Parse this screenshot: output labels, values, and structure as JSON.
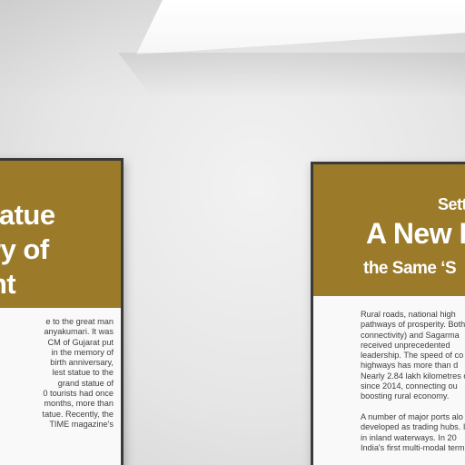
{
  "left_poster": {
    "headline": [
      "tatue",
      "ry of",
      "nt"
    ],
    "body": [
      "e to the great man",
      "anyakumari. It was",
      "CM of Gujarat put",
      "in the memory of",
      "birth anniversary,",
      "lest statue to the",
      "grand statue of",
      "0 tourists had once",
      "months, more than",
      "tatue. Recently, the",
      "TIME magazine's"
    ]
  },
  "right_poster": {
    "headline": [
      "Sett",
      "A New P",
      "the Same ‘S"
    ],
    "body_p1": [
      "Rural roads, national high",
      "pathways of prosperity. Both",
      "connectivity) and Sagarma",
      "received unprecedented",
      "leadership. The speed of co",
      "highways has more than d",
      "Nearly 2.84 lakh kilometres o",
      "since 2014, connecting ou",
      "boosting rural economy."
    ],
    "body_p2": [
      "A number of major ports alo",
      "developed as trading hubs. In",
      "in inland waterways. In 20",
      "India's first multi-modal term"
    ]
  },
  "colors": {
    "band": "#9b7a2a",
    "frame": "#3a3a3a",
    "wall": "#e6e6e6"
  }
}
